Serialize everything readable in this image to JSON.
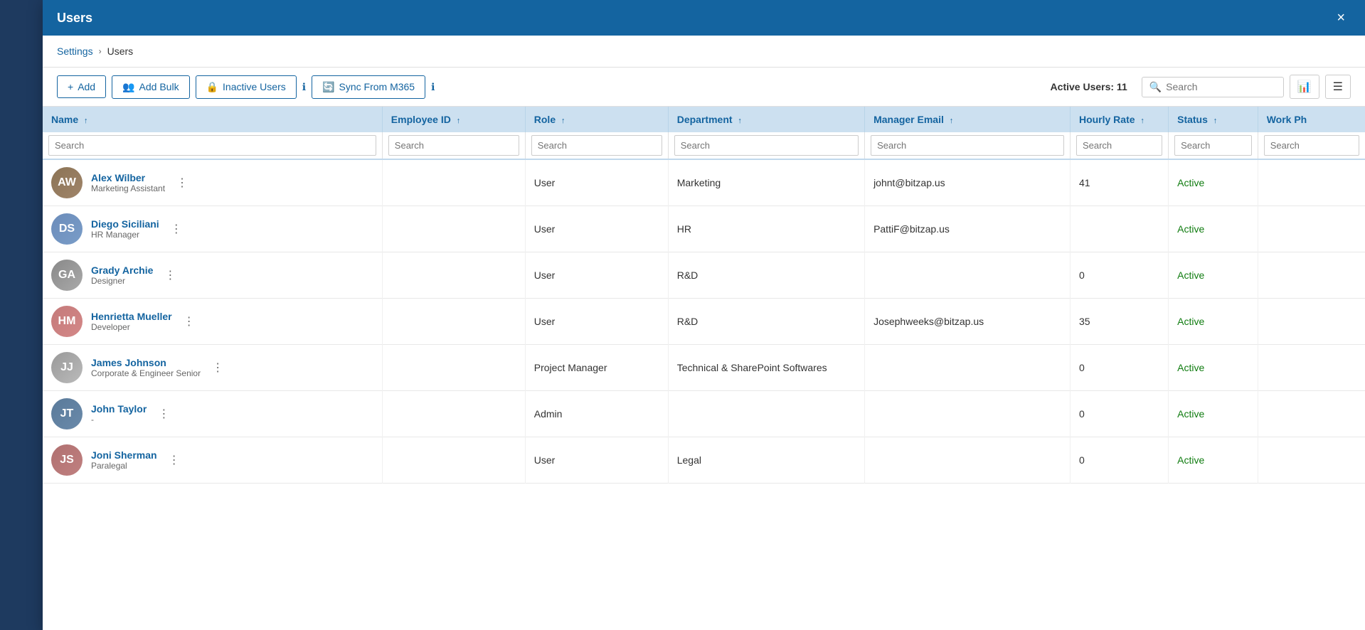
{
  "sidebar": {},
  "modal": {
    "title": "Users",
    "close_label": "×"
  },
  "breadcrumb": {
    "settings": "Settings",
    "separator": "›",
    "current": "Users"
  },
  "toolbar": {
    "add_label": "Add",
    "add_bulk_label": "Add Bulk",
    "inactive_users_label": "Inactive Users",
    "sync_label": "Sync From M365",
    "active_users_label": "Active Users: 11",
    "search_placeholder": "Search",
    "export_icon": "📊",
    "menu_icon": "☰"
  },
  "columns": [
    {
      "key": "name",
      "label": "Name",
      "sort": "↑"
    },
    {
      "key": "empid",
      "label": "Employee ID",
      "sort": "↑"
    },
    {
      "key": "role",
      "label": "Role",
      "sort": "↑"
    },
    {
      "key": "dept",
      "label": "Department",
      "sort": "↑"
    },
    {
      "key": "manager",
      "label": "Manager Email",
      "sort": "↑"
    },
    {
      "key": "hourly",
      "label": "Hourly Rate",
      "sort": "↑"
    },
    {
      "key": "status",
      "label": "Status",
      "sort": "↑"
    },
    {
      "key": "workph",
      "label": "Work Ph"
    }
  ],
  "col_search_placeholder": "Search",
  "users": [
    {
      "id": 1,
      "name": "Alex Wilber",
      "title": "Marketing Assistant",
      "emp_id": "",
      "role": "User",
      "department": "Marketing",
      "manager_email": "johnt@bitzap.us",
      "hourly_rate": "41",
      "status": "Active",
      "work_phone": "",
      "avatar_class": "av-alex",
      "avatar_initials": "AW"
    },
    {
      "id": 2,
      "name": "Diego Siciliani",
      "title": "HR Manager",
      "emp_id": "",
      "role": "User",
      "department": "HR",
      "manager_email": "PattiF@bitzap.us",
      "hourly_rate": "",
      "status": "Active",
      "work_phone": "",
      "avatar_class": "av-diego",
      "avatar_initials": "DS"
    },
    {
      "id": 3,
      "name": "Grady Archie",
      "title": "Designer",
      "emp_id": "",
      "role": "User",
      "department": "R&D",
      "manager_email": "",
      "hourly_rate": "0",
      "status": "Active",
      "work_phone": "",
      "avatar_class": "av-grady",
      "avatar_initials": "GA"
    },
    {
      "id": 4,
      "name": "Henrietta Mueller",
      "title": "Developer",
      "emp_id": "",
      "role": "User",
      "department": "R&D",
      "manager_email": "Josephweeks@bitzap.us",
      "hourly_rate": "35",
      "status": "Active",
      "work_phone": "",
      "avatar_class": "av-henrietta",
      "avatar_initials": "HM"
    },
    {
      "id": 5,
      "name": "James Johnson",
      "title": "Corporate & Engineer Senior",
      "emp_id": "",
      "role": "Project Manager",
      "department": "Technical & SharePoint Softwares",
      "manager_email": "",
      "hourly_rate": "0",
      "status": "Active",
      "work_phone": "",
      "avatar_class": "av-james",
      "avatar_initials": "JJ"
    },
    {
      "id": 6,
      "name": "John Taylor",
      "title": "-",
      "emp_id": "",
      "role": "Admin",
      "department": "",
      "manager_email": "",
      "hourly_rate": "0",
      "status": "Active",
      "work_phone": "",
      "avatar_class": "av-john",
      "avatar_initials": "JT"
    },
    {
      "id": 7,
      "name": "Joni Sherman",
      "title": "Paralegal",
      "emp_id": "",
      "role": "User",
      "department": "Legal",
      "manager_email": "",
      "hourly_rate": "0",
      "status": "Active",
      "work_phone": "",
      "avatar_class": "av-joni",
      "avatar_initials": "JS"
    }
  ]
}
